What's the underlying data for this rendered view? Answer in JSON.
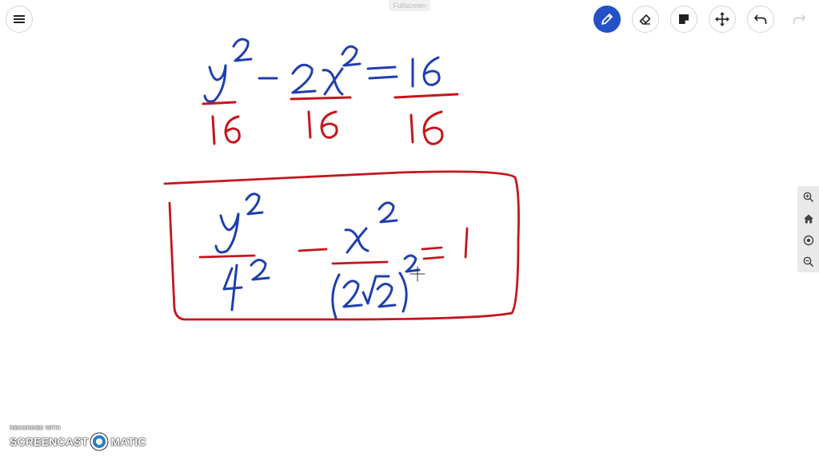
{
  "topbar": {
    "fullscreen_label": "Fullscreen",
    "tools": [
      {
        "name": "menu-icon"
      },
      {
        "name": "pencil-icon",
        "active": true
      },
      {
        "name": "eraser-icon"
      },
      {
        "name": "sticky-note-icon"
      },
      {
        "name": "move-icon"
      },
      {
        "name": "undo-icon"
      },
      {
        "name": "redo-icon",
        "disabled": true
      }
    ]
  },
  "zoom_panel": {
    "buttons": [
      "zoom-in-icon",
      "home-icon",
      "recenter-icon",
      "zoom-out-icon"
    ]
  },
  "whiteboard": {
    "ink_colors": {
      "blue": "#1f3fae",
      "red": "#c4161c"
    },
    "line1": {
      "terms": [
        "y²",
        "2x²",
        "16"
      ],
      "denominators": [
        "16",
        "16",
        "16"
      ],
      "operators": [
        "−",
        "="
      ]
    },
    "boxed_result": {
      "term1_numerator": "y²",
      "term1_denominator": "4²",
      "term2_numerator": "x²",
      "term2_denominator": "(2√2)²",
      "rhs": "1"
    }
  },
  "watermark": {
    "top": "RECORDED WITH",
    "left": "SCREENCAST",
    "right": "MATIC"
  },
  "colors": {
    "accent": "#2450c8",
    "panel": "#e9e9e9"
  }
}
